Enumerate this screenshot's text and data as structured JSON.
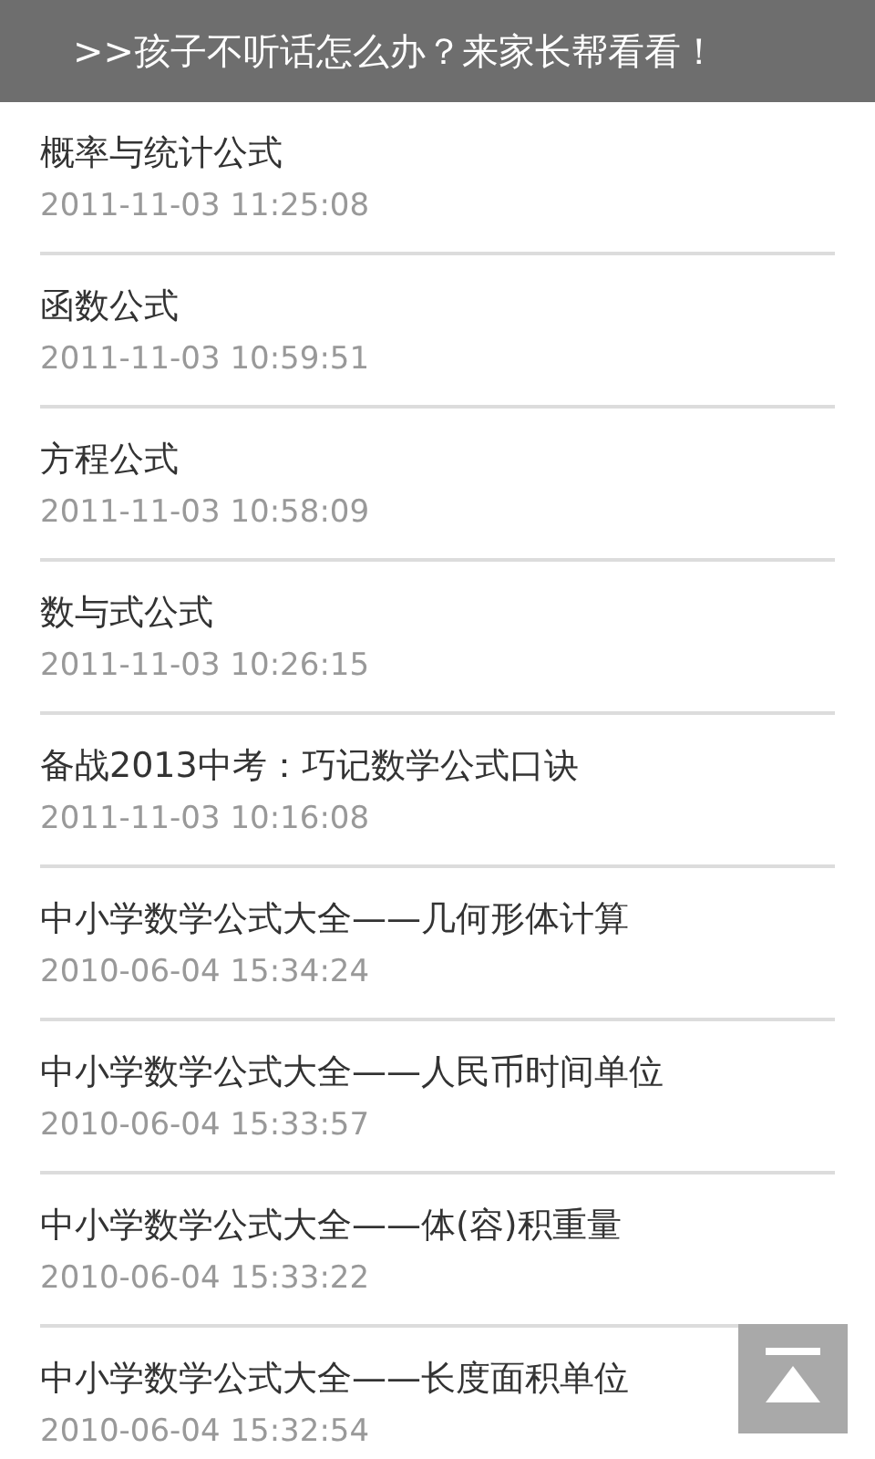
{
  "banner": {
    "text": ">>孩子不听话怎么办？来家长帮看看！"
  },
  "articles": [
    {
      "title": "概率与统计公式",
      "date": "2011-11-03 11:25:08"
    },
    {
      "title": "函数公式",
      "date": "2011-11-03 10:59:51"
    },
    {
      "title": "方程公式",
      "date": "2011-11-03 10:58:09"
    },
    {
      "title": "数与式公式",
      "date": "2011-11-03 10:26:15"
    },
    {
      "title": "备战2013中考：巧记数学公式口诀",
      "date": "2011-11-03 10:16:08"
    },
    {
      "title": "中小学数学公式大全——几何形体计算",
      "date": "2010-06-04 15:34:24"
    },
    {
      "title": "中小学数学公式大全——人民币时间单位",
      "date": "2010-06-04 15:33:57"
    },
    {
      "title": "中小学数学公式大全——体(容)积重量",
      "date": "2010-06-04 15:33:22"
    },
    {
      "title": "中小学数学公式大全——长度面积单位",
      "date": "2010-06-04 15:32:54"
    }
  ]
}
